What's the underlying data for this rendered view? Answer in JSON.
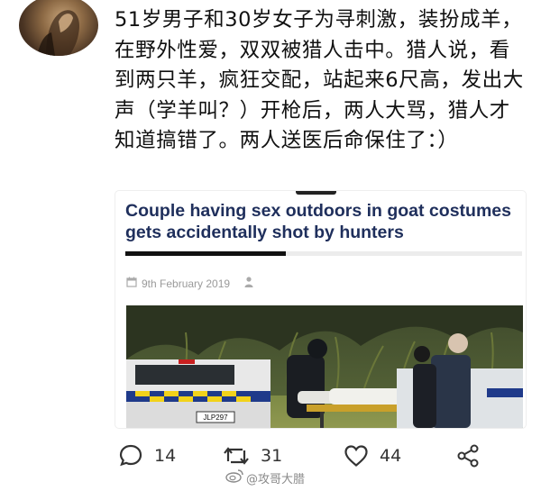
{
  "post": {
    "text": "51岁男子和30岁女子为寻刺激，装扮成羊，在野外性爱，双双被猎人击中。猎人说，看到两只羊，疯狂交配，站起来6尺高，发出大声（学羊叫？）开枪后，两人大骂，猎人才知道搞错了。两人送医后命保住了：）"
  },
  "card": {
    "headline": "Couple having sex outdoors in goat costumes gets accidentally shot by hunters",
    "date": "9th February 2019",
    "photo": {
      "plate": "JLP297"
    }
  },
  "actions": {
    "comments": "14",
    "reposts": "31",
    "likes": "44"
  },
  "watermark": {
    "text": "@攻哥大腊"
  },
  "colors": {
    "headline": "#1f2f5c",
    "police_blue": "#1f3a8a",
    "police_yellow": "#f2d21a"
  }
}
